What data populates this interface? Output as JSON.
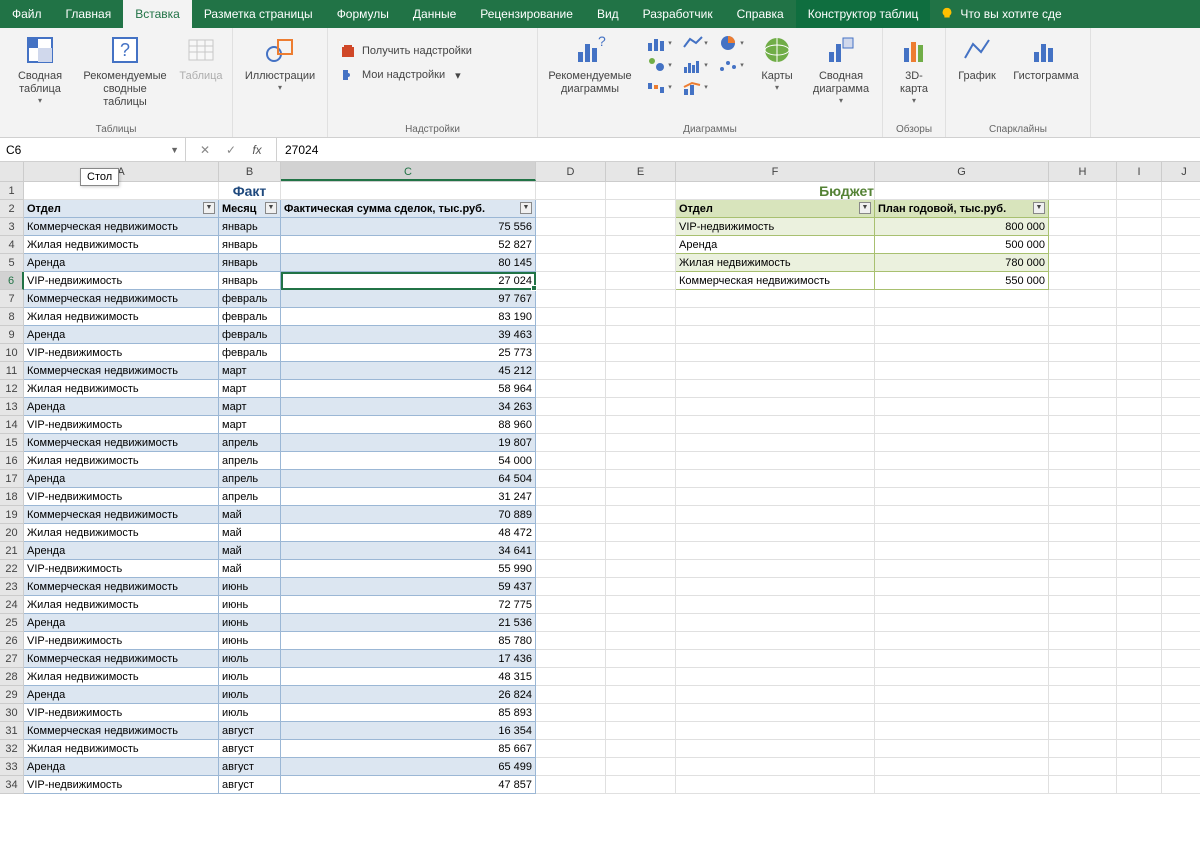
{
  "tabs": [
    "Файл",
    "Главная",
    "Вставка",
    "Разметка страницы",
    "Формулы",
    "Данные",
    "Рецензирование",
    "Вид",
    "Разработчик",
    "Справка",
    "Конструктор таблиц"
  ],
  "active_tab": 2,
  "tell_me": "Что вы хотите сде",
  "ribbon": {
    "groups": {
      "tables": "Таблицы",
      "illustrations": "",
      "addins": "Надстройки",
      "charts": "Диаграммы",
      "tours": "Обзоры",
      "spark": "Спарклайны"
    },
    "btns": {
      "pivot": "Сводная\nтаблица",
      "rec_pivot": "Рекомендуемые\nсводные таблицы",
      "table": "Таблица",
      "illus": "Иллюстрации",
      "get_addins": "Получить надстройки",
      "my_addins": "Мои надстройки",
      "rec_charts": "Рекомендуемые\nдиаграммы",
      "maps": "Карты",
      "pivot_chart": "Сводная\nдиаграмма",
      "map3d": "3D-\nкарта",
      "spark_line": "График",
      "spark_col": "Гистограмма"
    }
  },
  "name_box": "C6",
  "formula": "27024",
  "tooltip": "Стол",
  "columns": [
    "A",
    "B",
    "C",
    "D",
    "E",
    "F",
    "G",
    "H",
    "I",
    "J"
  ],
  "title_fact": "Факт",
  "title_budget": "Бюджет",
  "fact_headers": [
    "Отдел",
    "Месяц",
    "Фактическая сумма сделок, тыс.руб."
  ],
  "budget_headers": [
    "Отдел",
    "План годовой, тыс.руб."
  ],
  "budget_rows": [
    [
      "VIP-недвижимость",
      "800 000"
    ],
    [
      "Аренда",
      "500 000"
    ],
    [
      "Жилая недвижимость",
      "780 000"
    ],
    [
      "Коммерческая недвижимость",
      "550 000"
    ]
  ],
  "fact_rows": [
    [
      "Коммерческая недвижимость",
      "январь",
      "75 556"
    ],
    [
      "Жилая недвижимость",
      "январь",
      "52 827"
    ],
    [
      "Аренда",
      "январь",
      "80 145"
    ],
    [
      "VIP-недвижимость",
      "январь",
      "27 024"
    ],
    [
      "Коммерческая недвижимость",
      "февраль",
      "97 767"
    ],
    [
      "Жилая недвижимость",
      "февраль",
      "83 190"
    ],
    [
      "Аренда",
      "февраль",
      "39 463"
    ],
    [
      "VIP-недвижимость",
      "февраль",
      "25 773"
    ],
    [
      "Коммерческая недвижимость",
      "март",
      "45 212"
    ],
    [
      "Жилая недвижимость",
      "март",
      "58 964"
    ],
    [
      "Аренда",
      "март",
      "34 263"
    ],
    [
      "VIP-недвижимость",
      "март",
      "88 960"
    ],
    [
      "Коммерческая недвижимость",
      "апрель",
      "19 807"
    ],
    [
      "Жилая недвижимость",
      "апрель",
      "54 000"
    ],
    [
      "Аренда",
      "апрель",
      "64 504"
    ],
    [
      "VIP-недвижимость",
      "апрель",
      "31 247"
    ],
    [
      "Коммерческая недвижимость",
      "май",
      "70 889"
    ],
    [
      "Жилая недвижимость",
      "май",
      "48 472"
    ],
    [
      "Аренда",
      "май",
      "34 641"
    ],
    [
      "VIP-недвижимость",
      "май",
      "55 990"
    ],
    [
      "Коммерческая недвижимость",
      "июнь",
      "59 437"
    ],
    [
      "Жилая недвижимость",
      "июнь",
      "72 775"
    ],
    [
      "Аренда",
      "июнь",
      "21 536"
    ],
    [
      "VIP-недвижимость",
      "июнь",
      "85 780"
    ],
    [
      "Коммерческая недвижимость",
      "июль",
      "17 436"
    ],
    [
      "Жилая недвижимость",
      "июль",
      "48 315"
    ],
    [
      "Аренда",
      "июль",
      "26 824"
    ],
    [
      "VIP-недвижимость",
      "июль",
      "85 893"
    ],
    [
      "Коммерческая недвижимость",
      "август",
      "16 354"
    ],
    [
      "Жилая недвижимость",
      "август",
      "85 667"
    ],
    [
      "Аренда",
      "август",
      "65 499"
    ],
    [
      "VIP-недвижимость",
      "август",
      "47 857"
    ]
  ]
}
